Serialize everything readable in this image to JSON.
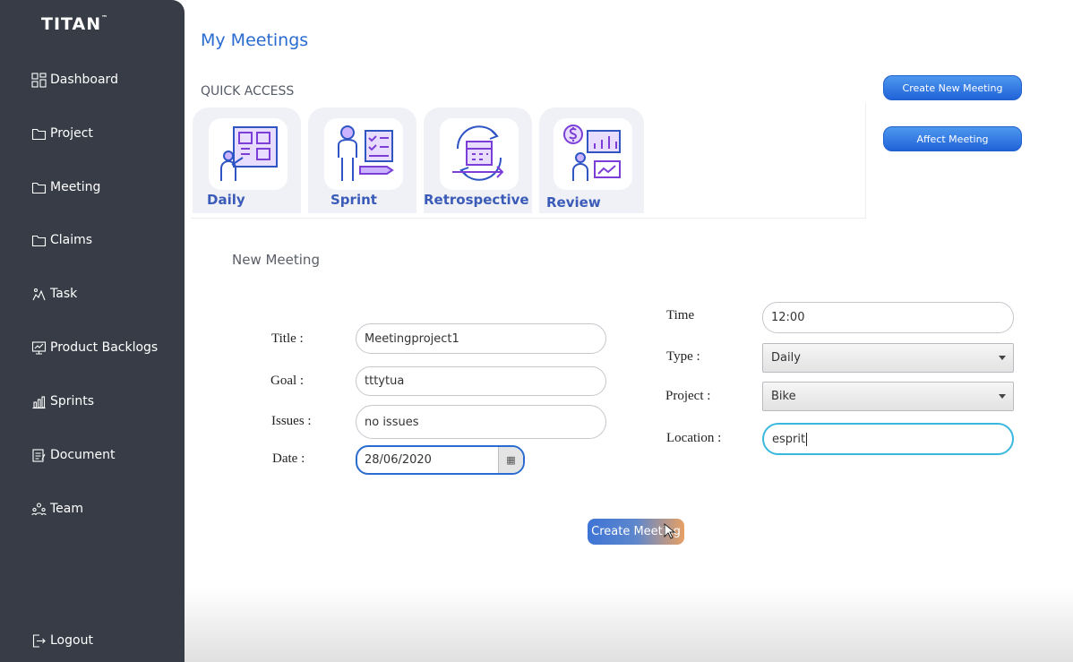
{
  "app": {
    "logo": "TITAN",
    "logo_tm": "™"
  },
  "sidebar": {
    "items": [
      {
        "label": "Dashboard",
        "icon": "dashboard-icon"
      },
      {
        "label": "Project",
        "icon": "folder-icon"
      },
      {
        "label": "Meeting",
        "icon": "folder-icon"
      },
      {
        "label": "Claims",
        "icon": "folder-icon"
      },
      {
        "label": "Task",
        "icon": "task-icon"
      },
      {
        "label": "Product Backlogs",
        "icon": "backlog-icon"
      },
      {
        "label": "Sprints",
        "icon": "chart-icon"
      },
      {
        "label": "Document",
        "icon": "document-icon"
      },
      {
        "label": "Team",
        "icon": "team-icon"
      }
    ],
    "logout": {
      "label": "Logout",
      "icon": "logout-icon"
    }
  },
  "header": {
    "title": "My Meetings"
  },
  "quick_access": {
    "label": "QUICK ACCESS",
    "cards": [
      {
        "label": "Daily",
        "icon": "whiteboard-presenter-icon"
      },
      {
        "label": "Sprint",
        "icon": "checklist-person-icon"
      },
      {
        "label": "Retrospective",
        "icon": "calendar-cycle-icon"
      },
      {
        "label": "Review",
        "icon": "finance-review-icon"
      }
    ]
  },
  "actions": {
    "create_new_meeting": "Create New Meeting",
    "affect_meeting": "Affect Meeting"
  },
  "form": {
    "section_title": "New Meeting",
    "title_label": "Title :",
    "title_value": "Meetingproject1",
    "goal_label": "Goal :",
    "goal_value": "tttytua",
    "issues_label": "Issues :",
    "issues_value": "no issues",
    "date_label": "Date :",
    "date_value": "28/06/2020",
    "time_label": "Time",
    "time_value": "12:00",
    "type_label": "Type :",
    "type_value": "Daily",
    "project_label": "Project :",
    "project_value": "Bike",
    "location_label": "Location :",
    "location_value": "esprit",
    "submit": "Create Meeting"
  },
  "colors": {
    "sidebar": "#373c46",
    "accent": "#2a6bd1",
    "card_label": "#3a5bb8",
    "focus": "#39b8de"
  }
}
